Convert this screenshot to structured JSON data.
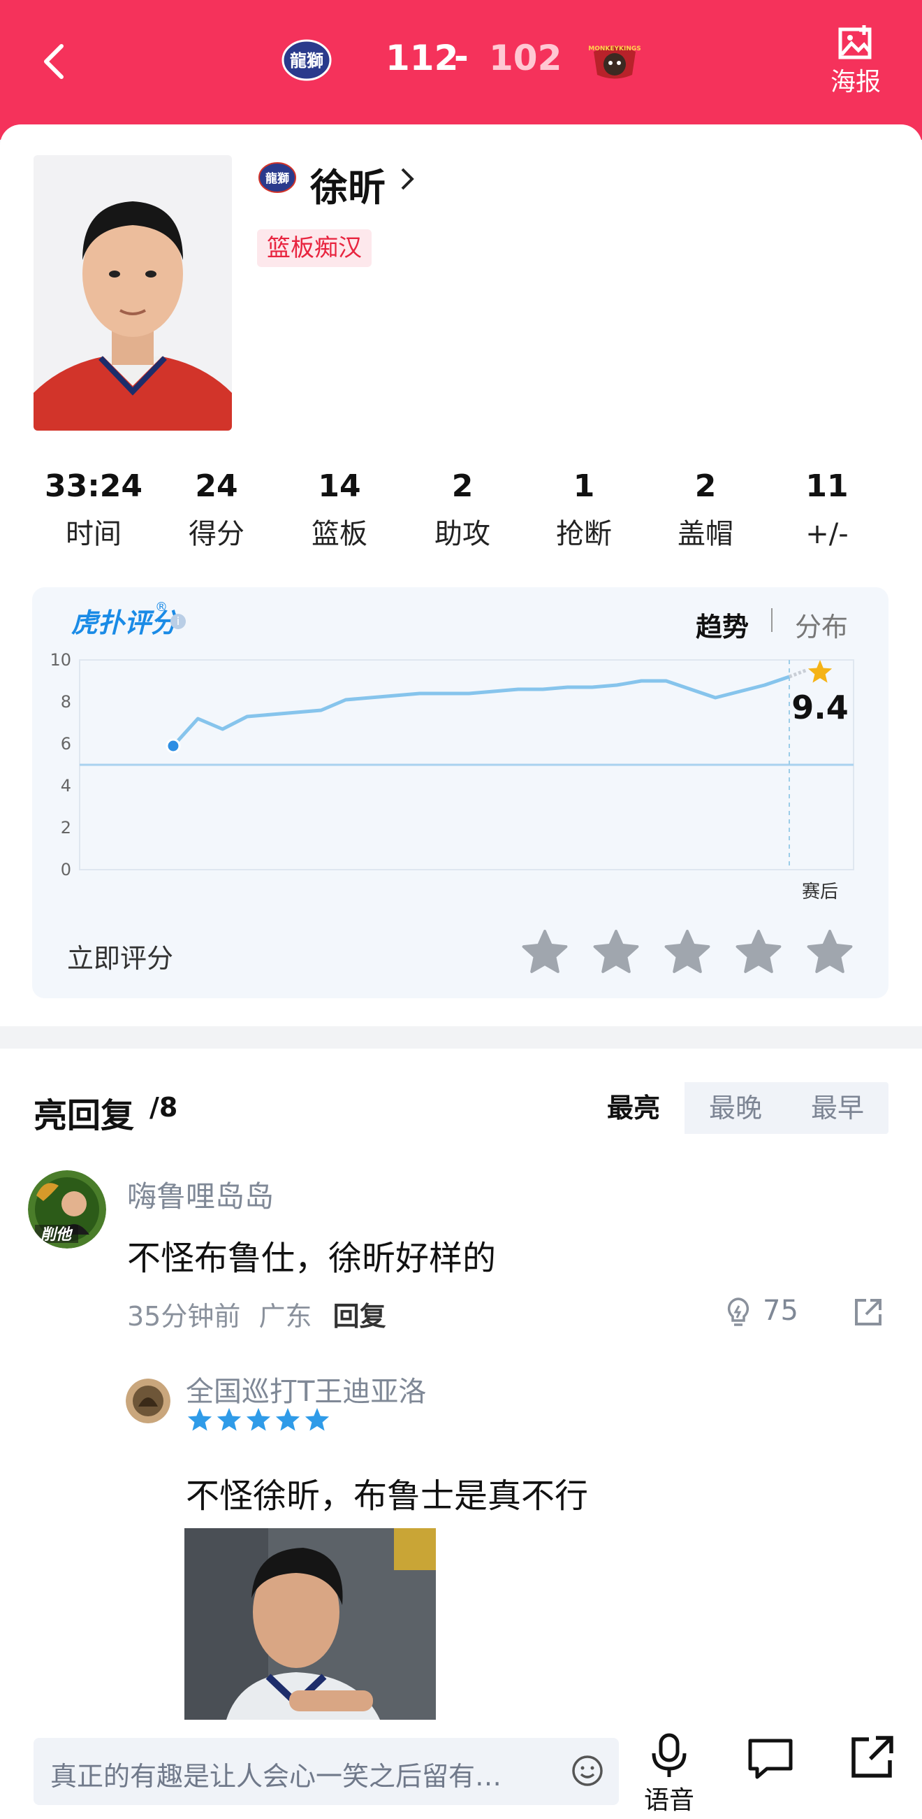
{
  "header": {
    "home_score": "112",
    "dash": "-",
    "away_score": "102",
    "poster_label": "海报",
    "home_logo_text": "龍獅",
    "away_logo_text": "MONKEYKINGS"
  },
  "player": {
    "name": "徐昕",
    "tag": "篮板痴汉",
    "team_logo_text": "龍獅"
  },
  "stats": [
    {
      "value": "33:24",
      "label": "时间"
    },
    {
      "value": "24",
      "label": "得分"
    },
    {
      "value": "14",
      "label": "篮板"
    },
    {
      "value": "2",
      "label": "助攻"
    },
    {
      "value": "1",
      "label": "抢断"
    },
    {
      "value": "2",
      "label": "盖帽"
    },
    {
      "value": "11",
      "label": "+/-"
    }
  ],
  "rating": {
    "brand": "虎扑评分",
    "brand_reg": "®",
    "info": "i",
    "tab_trend": "趋势",
    "tab_dist": "分布",
    "rate_now": "立即评分",
    "star_count": 5
  },
  "chart_data": {
    "type": "line",
    "y_ticks": [
      "10",
      "8",
      "6",
      "4",
      "2",
      "0"
    ],
    "ylim": [
      0,
      10
    ],
    "x_label": "赛后",
    "final_value": "9.4",
    "reference_line": 5.0,
    "series": [
      {
        "values": [
          5.9,
          7.2,
          6.7,
          7.3,
          7.4,
          7.5,
          7.6,
          8.1,
          8.2,
          8.3,
          8.4,
          8.4,
          8.4,
          8.5,
          8.6,
          8.6,
          8.7,
          8.7,
          8.8,
          9.0,
          9.0,
          8.6,
          8.2,
          8.5,
          8.8,
          9.2
        ]
      }
    ],
    "colors": {
      "line": "#86c4ec",
      "start_point": "#2d8ee3",
      "reference": "#a9d2ef",
      "star": "#f5b316"
    }
  },
  "replies": {
    "title": "亮回复",
    "count": "/8",
    "sort_tabs": [
      "最亮",
      "最晚",
      "最早"
    ],
    "active_sort": 0,
    "comment": {
      "user": "嗨鲁哩岛岛",
      "text": "不怪布鲁仕，徐昕好样的",
      "time": "35分钟前",
      "location": "广东",
      "reply_label": "回复",
      "likes": "75",
      "avatar_badge": "削他"
    },
    "sub_comment": {
      "user": "全国巡打T王迪亚洛",
      "stars": 5,
      "text": "不怪徐昕，布鲁士是真不行"
    }
  },
  "bottom": {
    "placeholder": "真正的有趣是让人会心一笑之后留有…",
    "voice_label": "语音"
  }
}
